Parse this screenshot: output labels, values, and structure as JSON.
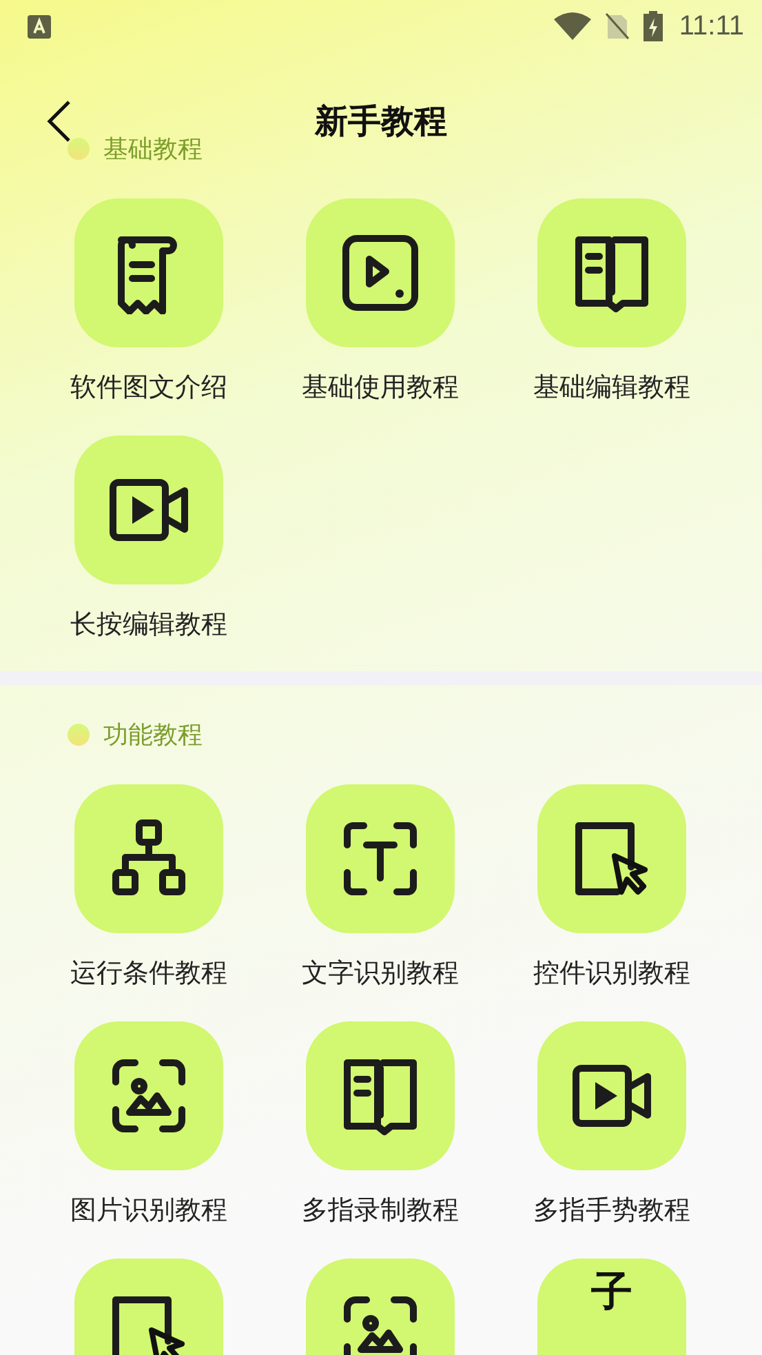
{
  "status_bar": {
    "time": "11:11"
  },
  "app_bar": {
    "title": "新手教程"
  },
  "sections": [
    {
      "title": "基础教程",
      "items": [
        {
          "label": "软件图文介绍",
          "kind": "scroll"
        },
        {
          "label": "基础使用教程",
          "kind": "play"
        },
        {
          "label": "基础编辑教程",
          "kind": "book"
        },
        {
          "label": "长按编辑教程",
          "kind": "video"
        }
      ]
    },
    {
      "title": "功能教程",
      "items": [
        {
          "label": "运行条件教程",
          "kind": "hierarchy"
        },
        {
          "label": "文字识别教程",
          "kind": "textscan"
        },
        {
          "label": "控件识别教程",
          "kind": "cursor"
        },
        {
          "label": "图片识别教程",
          "kind": "imagescan"
        },
        {
          "label": "多指录制教程",
          "kind": "book"
        },
        {
          "label": "多指手势教程",
          "kind": "video"
        },
        {
          "kind": "cursor"
        },
        {
          "kind": "imagescan"
        },
        {
          "kind": "glyph",
          "glyph": "子"
        }
      ]
    }
  ]
}
